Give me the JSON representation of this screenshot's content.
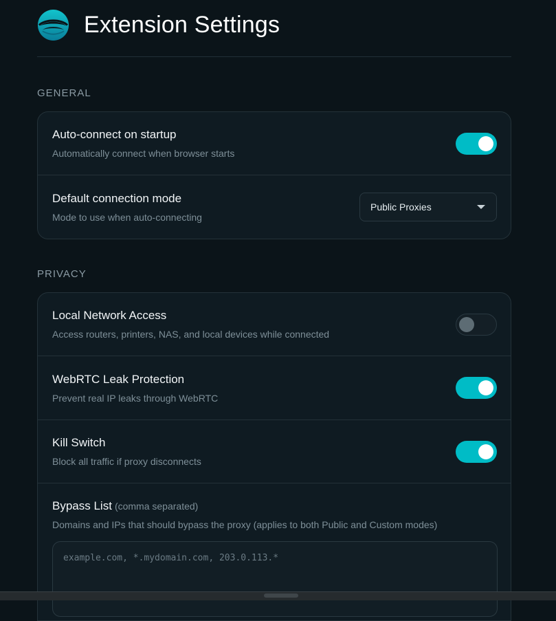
{
  "header": {
    "title": "Extension Settings",
    "logo_icon": "wave-globe-logo",
    "accent_color": "#00bcc6"
  },
  "general": {
    "section_label": "GENERAL",
    "auto_connect": {
      "title": "Auto-connect on startup",
      "description": "Automatically connect when browser starts",
      "enabled": true
    },
    "default_mode": {
      "title": "Default connection mode",
      "description": "Mode to use when auto-connecting",
      "selected": "Public Proxies"
    }
  },
  "privacy": {
    "section_label": "PRIVACY",
    "local_network": {
      "title": "Local Network Access",
      "description": "Access routers, printers, NAS, and local devices while connected",
      "enabled": false
    },
    "webrtc": {
      "title": "WebRTC Leak Protection",
      "description": "Prevent real IP leaks through WebRTC",
      "enabled": true
    },
    "kill_switch": {
      "title": "Kill Switch",
      "description": "Block all traffic if proxy disconnects",
      "enabled": true
    },
    "bypass": {
      "title": "Bypass List",
      "hint": "(comma separated)",
      "description": "Domains and IPs that should bypass the proxy (applies to both Public and Custom modes)",
      "placeholder": "example.com, *.mydomain.com, 203.0.113.*"
    }
  }
}
